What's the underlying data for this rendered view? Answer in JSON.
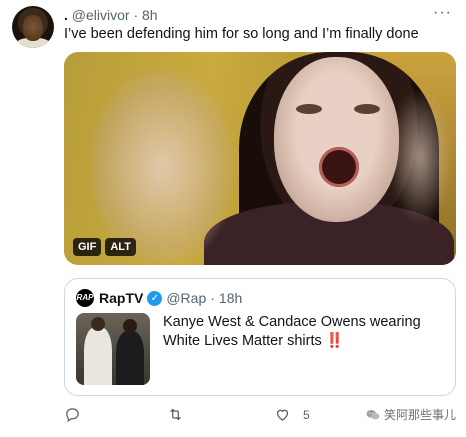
{
  "tweet": {
    "display_name": ".",
    "handle": "@elivivor",
    "separator": "·",
    "time": "8h",
    "text": "I’ve been defending him for so long and I’m finally done",
    "media": {
      "badges": [
        "GIF",
        "ALT"
      ]
    },
    "quoted_tweet": {
      "avatar_text": "RAP",
      "name": "RapTV",
      "handle": "@Rap",
      "separator": "·",
      "time": "18h",
      "text": "Kanye West & Candace Owens wearing White Lives Matter shirts",
      "emoji": "‼️"
    },
    "actions": {
      "reply_icon": "reply-icon",
      "retweet_icon": "retweet-icon",
      "like_icon": "heart-icon",
      "like_count": "5",
      "share_icon": "share-icon"
    },
    "watermark": "笑阿那些事儿"
  },
  "colors": {
    "text_primary": "#0f1419",
    "text_secondary": "#536471",
    "verified": "#1d9bf0",
    "border": "#cfd9de"
  }
}
